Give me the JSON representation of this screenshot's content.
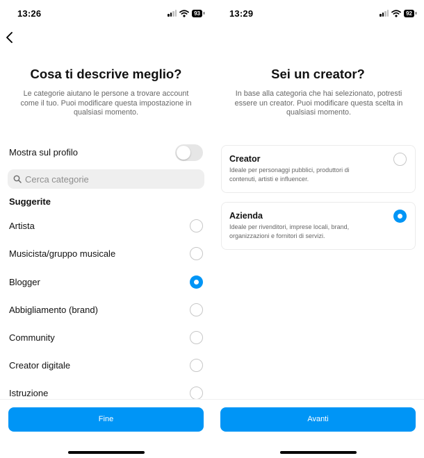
{
  "left_screen": {
    "status_time": "13:26",
    "battery": "93",
    "title": "Cosa ti descrive meglio?",
    "subtitle": "Le categorie aiutano le persone a trovare account come il tuo. Puoi modificare questa impostazione in qualsiasi momento.",
    "toggle_label": "Mostra sul profilo",
    "toggle_on": false,
    "search_placeholder": "Cerca categorie",
    "section_title": "Suggerite",
    "categories": [
      {
        "label": "Artista",
        "selected": false
      },
      {
        "label": "Musicista/gruppo musicale",
        "selected": false
      },
      {
        "label": "Blogger",
        "selected": true
      },
      {
        "label": "Abbigliamento (brand)",
        "selected": false
      },
      {
        "label": "Community",
        "selected": false
      },
      {
        "label": "Creator digitale",
        "selected": false
      },
      {
        "label": "Istruzione",
        "selected": false
      }
    ],
    "button_label": "Fine"
  },
  "right_screen": {
    "status_time": "13:29",
    "battery": "92",
    "title": "Sei un creator?",
    "subtitle": "In base alla categoria che hai selezionato, potresti essere un creator. Puoi modificare questa scelta in qualsiasi momento.",
    "options": [
      {
        "title": "Creator",
        "description": "Ideale per personaggi pubblici, produttori di contenuti, artisti e influencer.",
        "selected": false
      },
      {
        "title": "Azienda",
        "description": "Ideale per rivenditori, imprese locali, brand, organizzazioni e fornitori di servizi.",
        "selected": true
      }
    ],
    "button_label": "Avanti"
  },
  "colors": {
    "accent": "#0095f6",
    "search_bg": "#efefef",
    "secondary_text": "#666666"
  }
}
